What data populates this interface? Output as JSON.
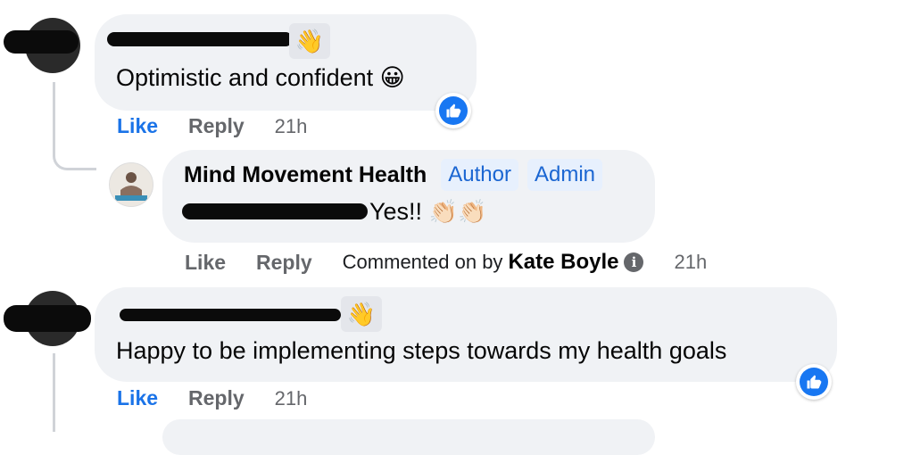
{
  "comments": [
    {
      "text": "Optimistic and confident",
      "emoji": "😀",
      "actions": {
        "like": "Like",
        "reply": "Reply",
        "time": "21h"
      }
    },
    {
      "author": "Mind Movement Health",
      "badges": [
        "Author",
        "Admin"
      ],
      "text": "Yes!!",
      "emoji": "👏🏻👏🏻",
      "actions": {
        "like": "Like",
        "reply": "Reply",
        "time": "21h"
      },
      "commented_on_by_prefix": "Commented on by",
      "commented_on_by_name": "Kate Boyle"
    },
    {
      "text": "Happy to be implementing steps towards my health goals",
      "actions": {
        "like": "Like",
        "reply": "Reply",
        "time": "21h"
      }
    }
  ],
  "icons": {
    "wave": "waving-hand-icon",
    "like": "thumbs-up-icon",
    "info": "info-icon"
  },
  "colors": {
    "like_blue": "#1877f2",
    "bubble_bg": "#f0f2f5",
    "badge_bg": "#e7f0fd",
    "badge_text": "#1b66d2",
    "muted": "#65676b"
  }
}
